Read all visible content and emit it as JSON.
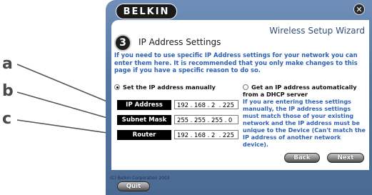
{
  "callouts": {
    "a": "a",
    "b": "b",
    "c": "c"
  },
  "window": {
    "logo_text": "BELKIN",
    "close_glyph": "⊗",
    "wizard_title": "Wireless Setup Wizard",
    "step_number": "3",
    "page_title": "IP Address Settings",
    "intro_text": "If you need to use specific IP Address settings for your network you can enter them here. It is recommended that you only make changes to this page if you have a specific reason to do so.",
    "option_manual": "Set the IP address manually",
    "option_dhcp": "Get an IP address automatically from a DHCP server",
    "manual_selected": true
  },
  "fields": {
    "ip_address": {
      "label": "IP Address",
      "value": "192 . 168 . 2  . 225"
    },
    "subnet_mask": {
      "label": "Subnet Mask",
      "value": "255 . 255 . 255 . 0"
    },
    "router": {
      "label": "Router",
      "value": "192 . 168 . 2  . 225"
    }
  },
  "help_text": "If you are entering these settings manually, the IP address settings must match those of your existing network and the IP address must be unique to the Device (Can't match the IP address of another network device).",
  "buttons": {
    "back": "Back",
    "next": "Next",
    "quit": "Quit"
  },
  "footer": {
    "copyright": "(C) Belkin Corporation 2003"
  },
  "colors": {
    "chrome": "#56779f",
    "help_text": "#2f63b5",
    "label_bg": "#000000"
  }
}
